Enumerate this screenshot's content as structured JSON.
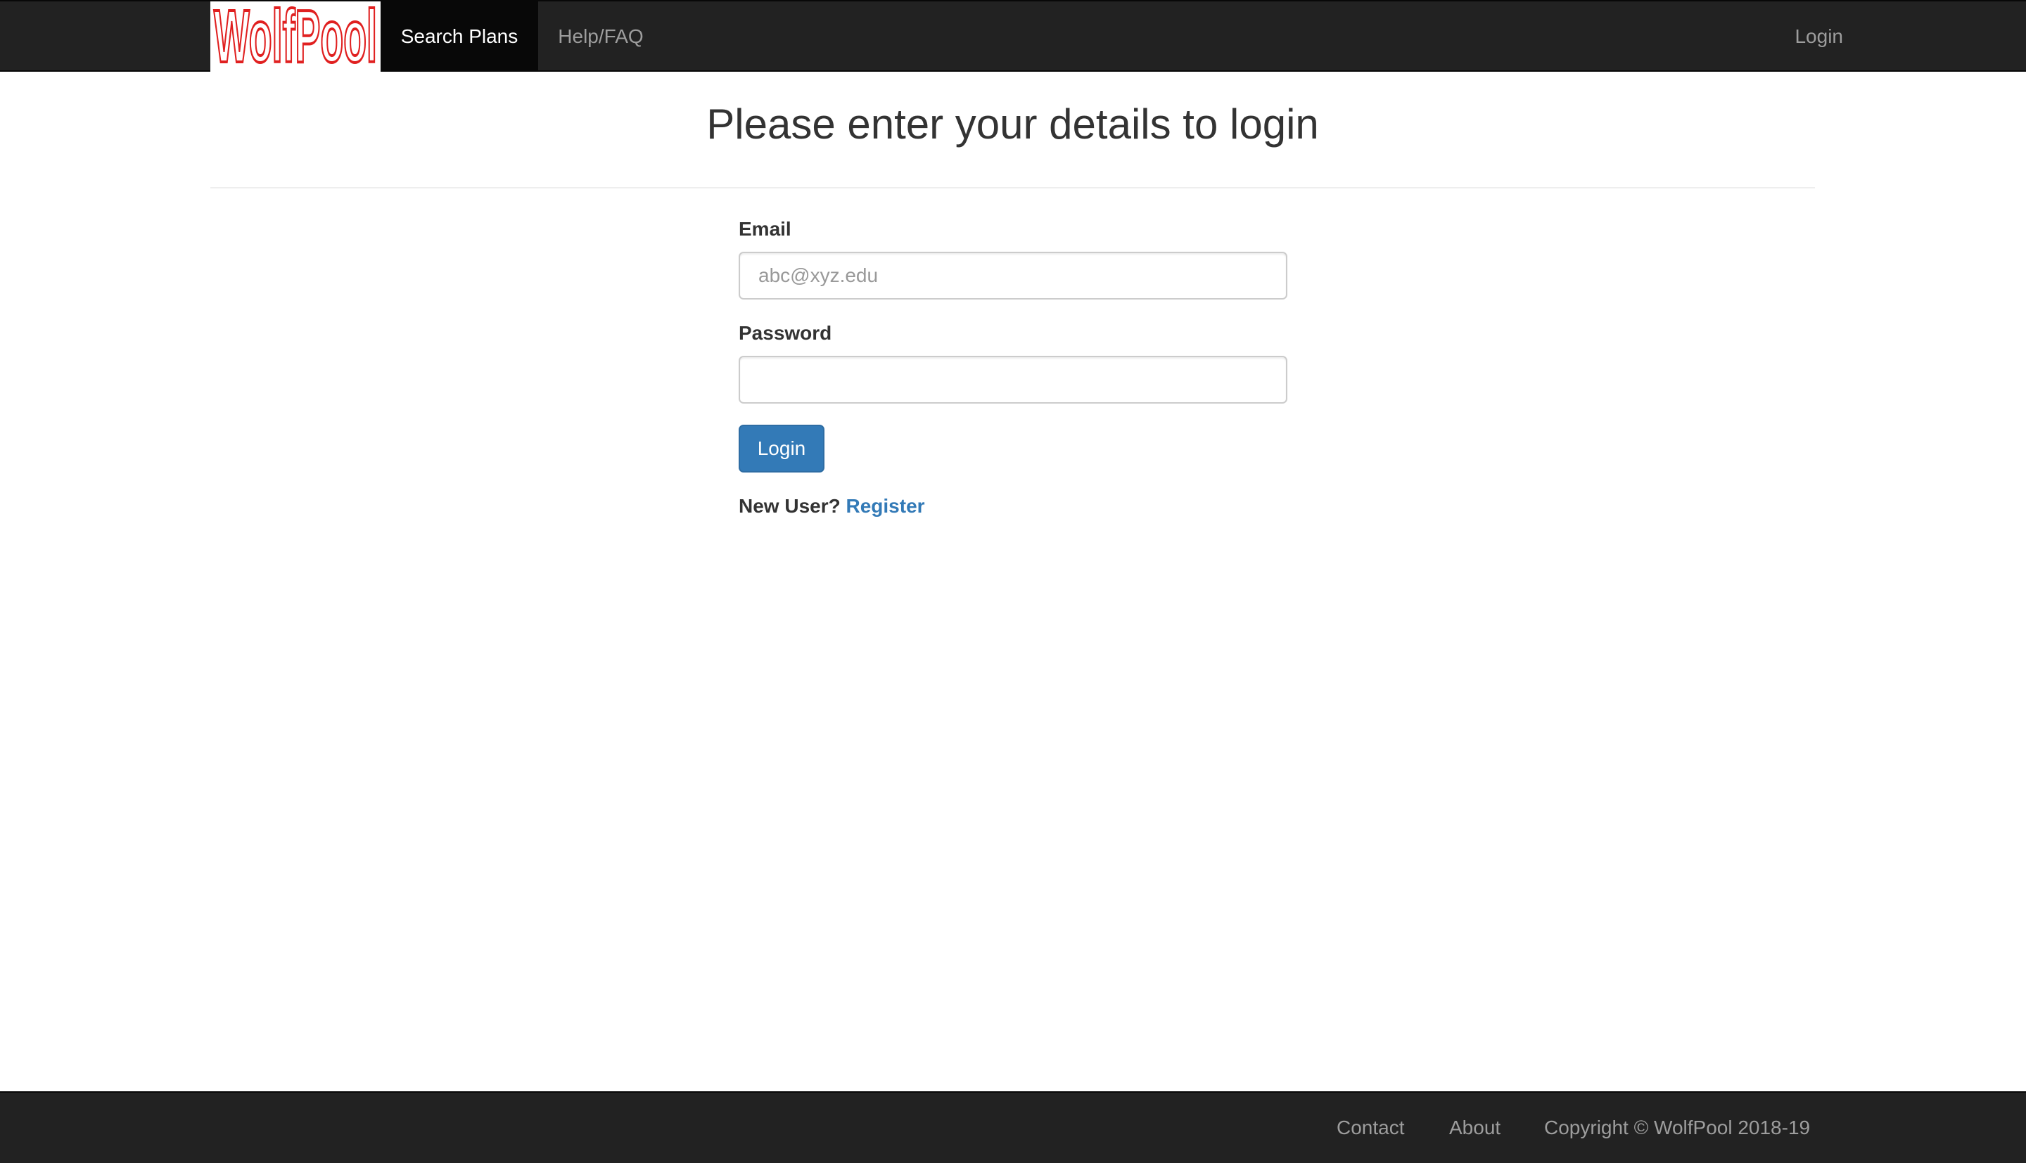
{
  "navbar": {
    "brand": "WolfPool",
    "items": [
      {
        "label": "Search Plans",
        "active": true
      },
      {
        "label": "Help/FAQ",
        "active": false
      }
    ],
    "login_label": "Login"
  },
  "page": {
    "title": "Please enter your details to login"
  },
  "form": {
    "email_label": "Email",
    "email_placeholder": "abc@xyz.edu",
    "email_value": "",
    "password_label": "Password",
    "password_value": "",
    "submit_label": "Login",
    "new_user_text": "New User?",
    "register_label": "Register"
  },
  "footer": {
    "contact_label": "Contact",
    "about_label": "About",
    "copyright": "Copyright © WolfPool 2018-19"
  },
  "colors": {
    "navbar_bg": "#222222",
    "active_nav_bg": "#080808",
    "primary": "#337ab7",
    "logo_red": "#e02020"
  }
}
